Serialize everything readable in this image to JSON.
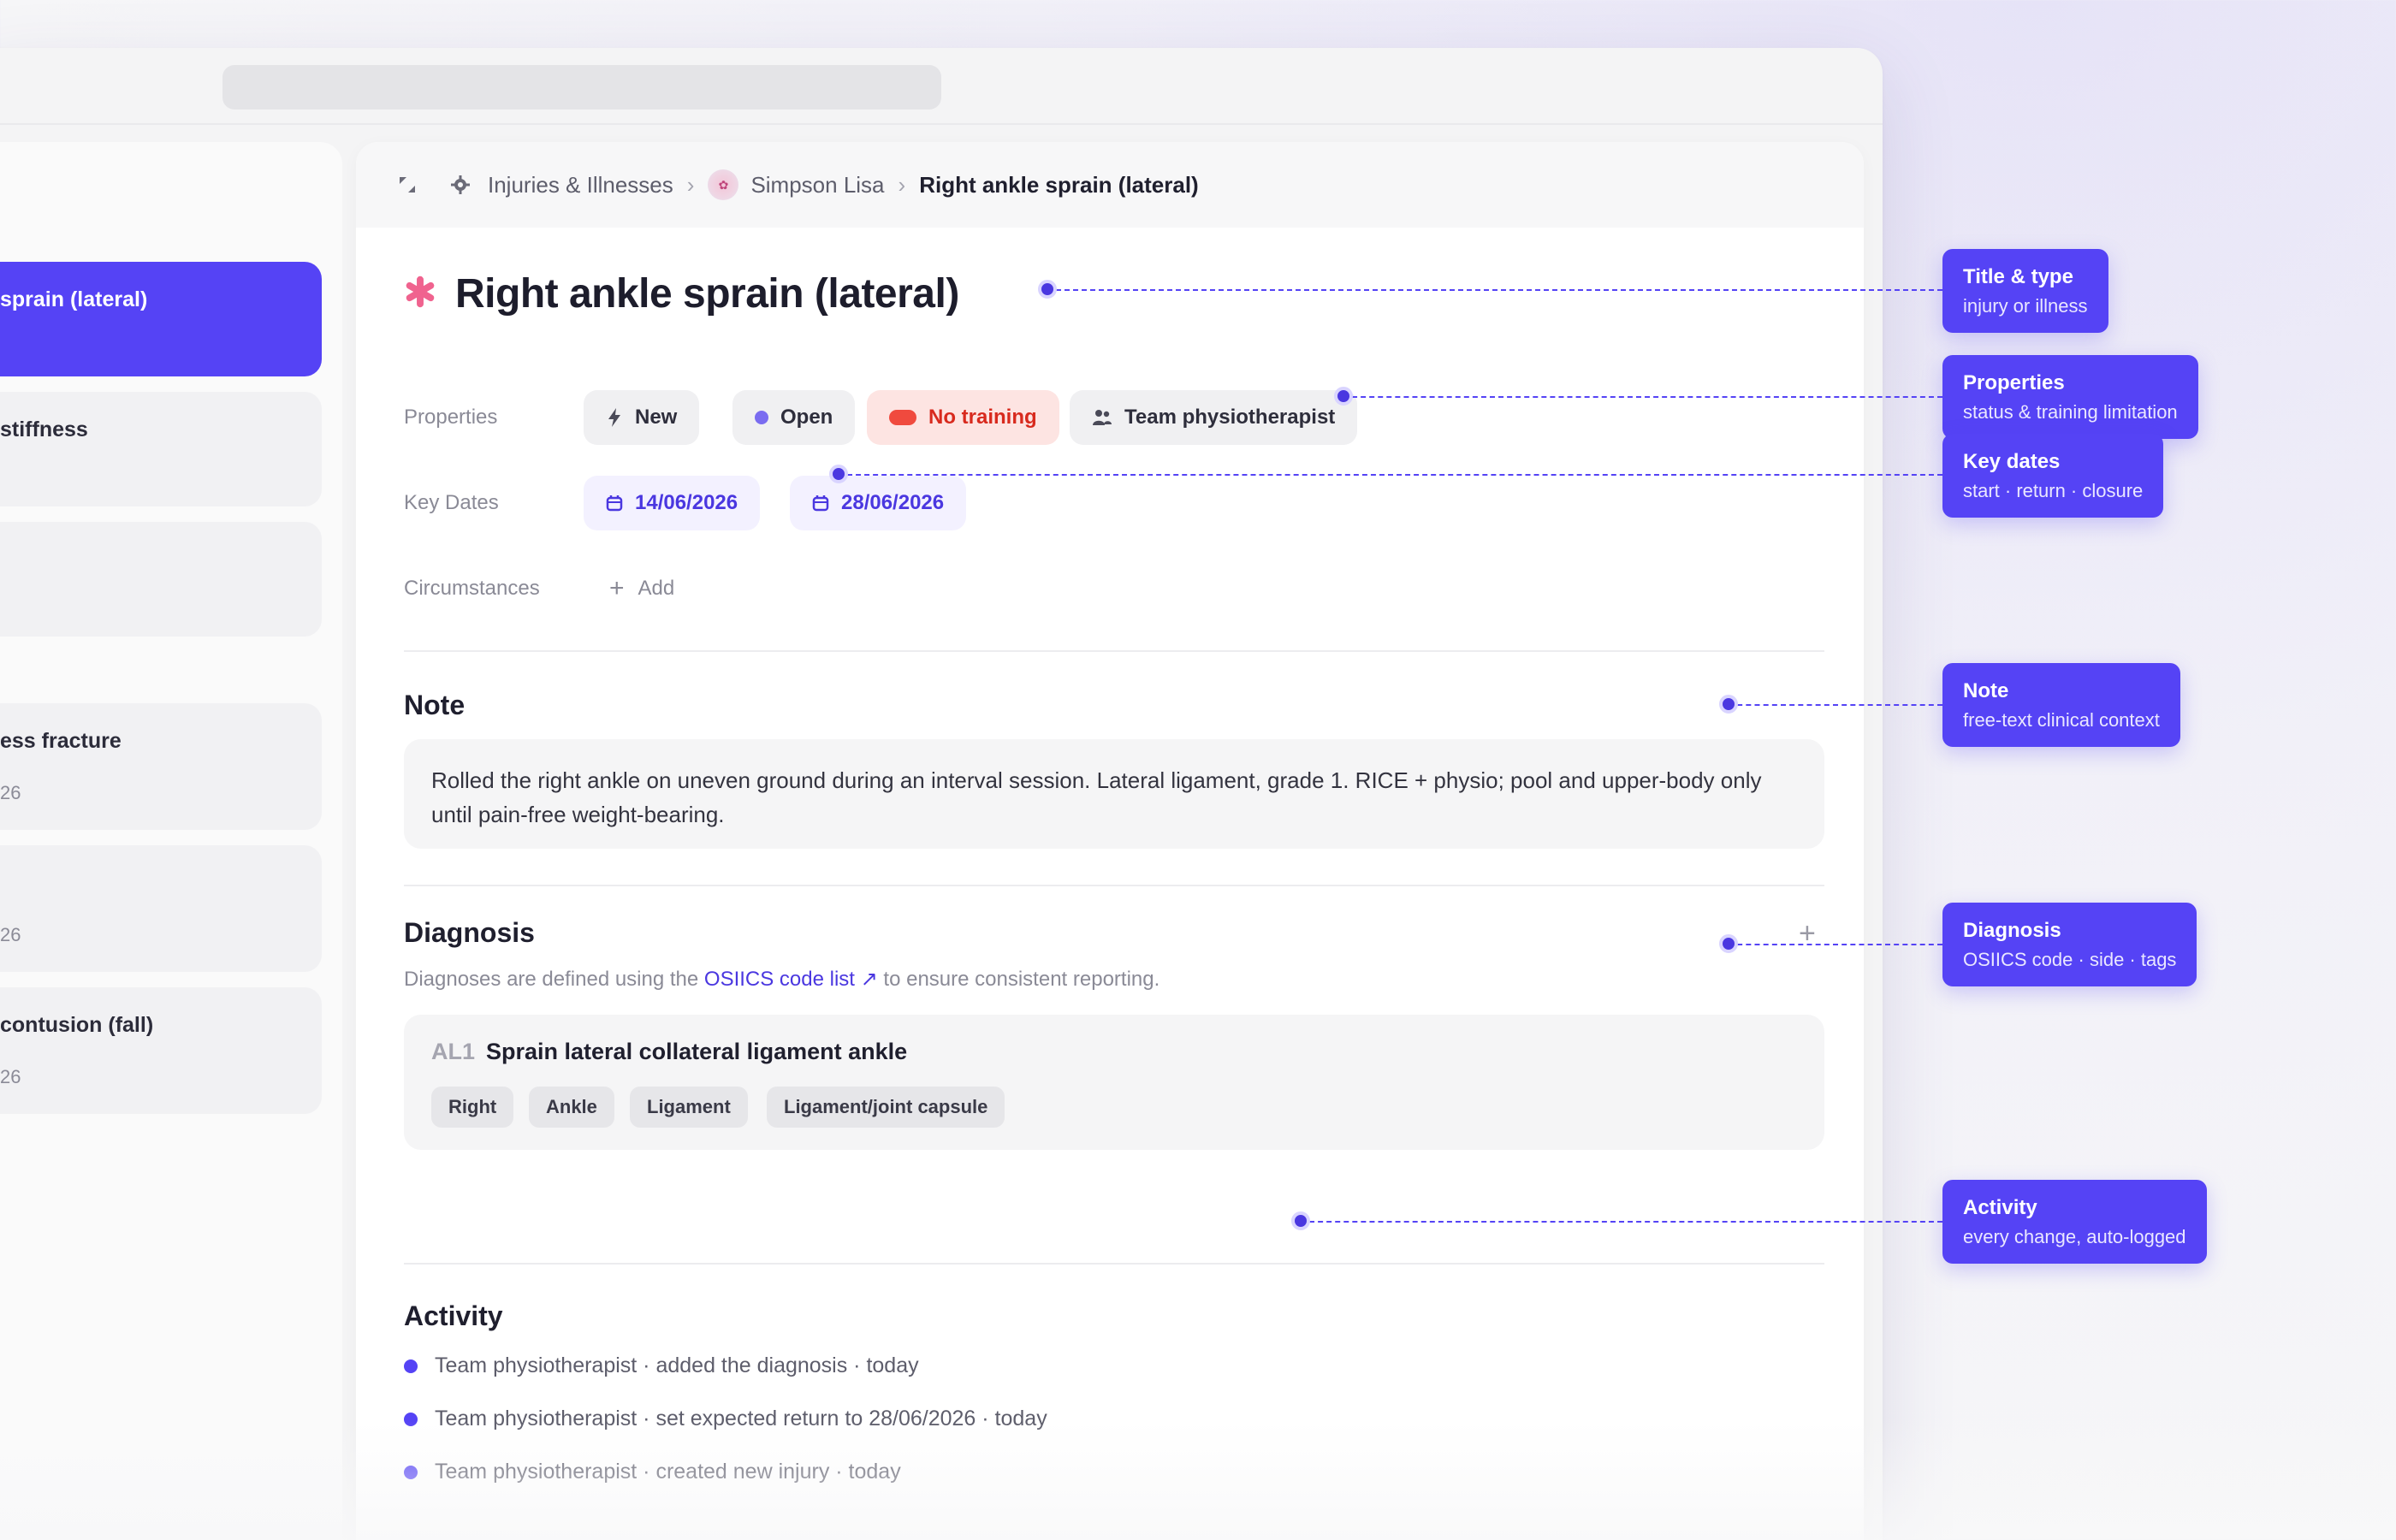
{
  "sidebar": {
    "items": [
      {
        "title": " sprain (lateral)",
        "subtitle": "",
        "active": true
      },
      {
        "title": " stiffness",
        "subtitle": ""
      },
      {
        "title": "",
        "subtitle": ""
      },
      {
        "title": "ess fracture",
        "subtitle": "26"
      },
      {
        "title": "",
        "subtitle": "26"
      },
      {
        "title": " contusion (fall)",
        "subtitle": "26"
      }
    ]
  },
  "breadcrumb": {
    "section": "Injuries & Illnesses",
    "athlete": "Simpson Lisa",
    "current": "Right ankle sprain (lateral)"
  },
  "injury": {
    "title": "Right ankle sprain (lateral)",
    "properties_label": "Properties",
    "properties": [
      "New",
      "Open",
      "No training",
      "Team physiotherapist"
    ],
    "key_dates_label": "Key Dates",
    "key_dates": [
      "14/06/2026",
      "28/06/2026"
    ],
    "circumstances_label": "Circumstances",
    "add_label": "Add"
  },
  "note": {
    "title": "Note",
    "text": "Rolled the right ankle on uneven ground during an interval session. Lateral ligament, grade 1. RICE + physio; pool and upper-body only until pain-free weight-bearing."
  },
  "diagnosis": {
    "title": "Diagnosis",
    "desc_before": "Diagnoses are defined using the ",
    "link_label": "OSIICS code list",
    "desc_after": " to ensure consistent reporting.",
    "code": "AL1",
    "name": "Sprain lateral collateral ligament ankle",
    "tags": [
      "Right",
      "Ankle",
      "Ligament",
      "Ligament/joint capsule"
    ]
  },
  "activity": {
    "title": "Activity",
    "items": [
      "Team physiotherapist · added the diagnosis · today",
      "Team physiotherapist · set expected return to 28/06/2026 · today",
      "Team physiotherapist · created new injury · today"
    ]
  },
  "callouts": [
    {
      "title": "Title & type",
      "subtitle": "injury or illness"
    },
    {
      "title": "Properties",
      "subtitle": "status & training limitation"
    },
    {
      "title": "Key dates",
      "subtitle": "start · return · closure"
    },
    {
      "title": "Note",
      "subtitle": "free-text clinical context"
    },
    {
      "title": "Diagnosis",
      "subtitle": "OSIICS code · side · tags"
    },
    {
      "title": "Activity",
      "subtitle": "every change, auto-logged"
    }
  ],
  "colors": {
    "accent": "#5543f5",
    "danger": "#d82a1e",
    "injury_icon": "#f0638f"
  }
}
